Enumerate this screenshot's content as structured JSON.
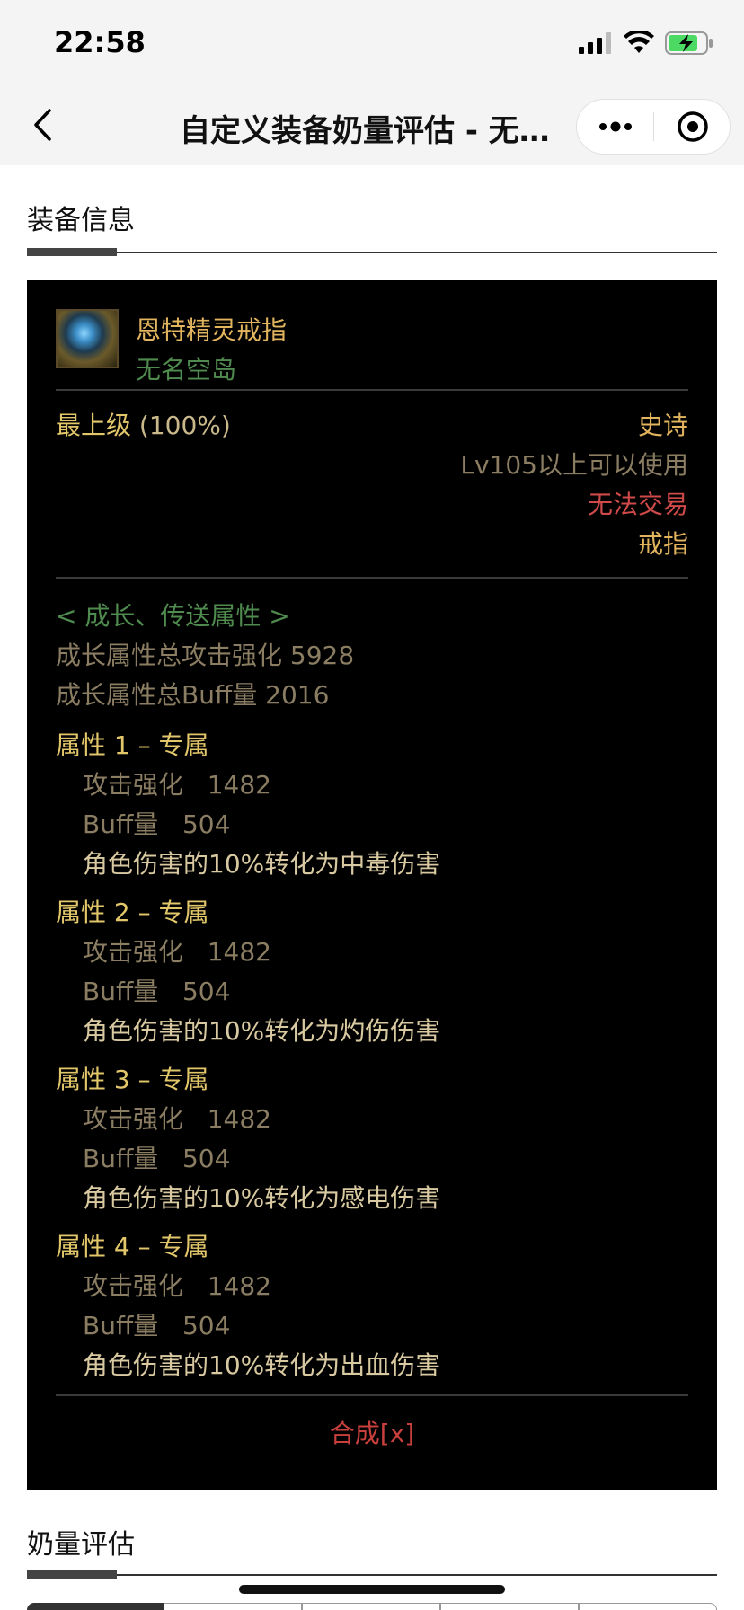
{
  "status_bar": {
    "time": "22:58"
  },
  "nav": {
    "title": "自定义装备奶量评估 - 无名空岛"
  },
  "section1": {
    "title": "装备信息"
  },
  "item": {
    "name": "恩特精灵戒指",
    "subtitle": "无名空岛",
    "grade_label": "最上级",
    "grade_pct": "(100%)",
    "rarity": "史诗",
    "level_req": "Lv105以上可以使用",
    "trade": "无法交易",
    "slot": "戒指"
  },
  "growth": {
    "header": "< 成长、传送属性 >",
    "total_attack": "成长属性总攻击强化 5928",
    "total_buff": "成长属性总Buff量 2016",
    "attributes": [
      {
        "title": "属性 1 – 专属",
        "attack": "攻击强化   1482",
        "buff": "Buff量   504",
        "effect": "角色伤害的10%转化为中毒伤害"
      },
      {
        "title": "属性 2 – 专属",
        "attack": "攻击强化   1482",
        "buff": "Buff量   504",
        "effect": "角色伤害的10%转化为灼伤伤害"
      },
      {
        "title": "属性 3 – 专属",
        "attack": "攻击强化   1482",
        "buff": "Buff量   504",
        "effect": "角色伤害的10%转化为感电伤害"
      },
      {
        "title": "属性 4 – 专属",
        "attack": "攻击强化   1482",
        "buff": "Buff量   504",
        "effect": "角色伤害的10%转化为出血伤害"
      }
    ]
  },
  "footer_label": "合成[x]",
  "section2": {
    "title": "奶量评估"
  }
}
